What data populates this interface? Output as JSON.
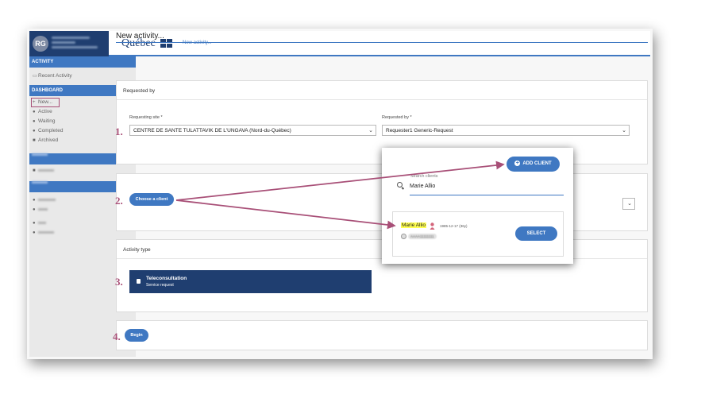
{
  "sidebar": {
    "avatar_initials": "RG",
    "sections": {
      "activity": "ACTIVITY",
      "dashboard": "DASHBOARD"
    },
    "activity_items": [
      {
        "label": "Recent Activity",
        "icon": "clock-icon"
      }
    ],
    "dashboard_items": [
      {
        "label": "New...",
        "icon": "plus-icon"
      },
      {
        "label": "Active",
        "icon": "info-icon"
      },
      {
        "label": "Waiting",
        "icon": "clock-icon"
      },
      {
        "label": "Completed",
        "icon": "check-icon"
      },
      {
        "label": "Archived",
        "icon": "folder-icon"
      }
    ]
  },
  "header": {
    "logo": "Québec",
    "breadcrumb": "New activity..."
  },
  "main": {
    "title": "New activity...",
    "requested_by": {
      "heading": "Requested by",
      "site_label": "Requesting site *",
      "site_value": "CENTRE DE SANTE TULATTAVIK DE L'UNGAVA (Nord-du-Québec)",
      "requester_label": "Requested by *",
      "requester_value": "Requester1 Generic-Request"
    },
    "client": {
      "choose_button": "Choose a client"
    },
    "activity_type": {
      "heading": "Activity type",
      "tile_title": "Teleconsultation",
      "tile_subtitle": "Service request"
    },
    "begin_button": "Begin"
  },
  "steps": [
    "1.",
    "2.",
    "3.",
    "4."
  ],
  "popup": {
    "add_client_button": "ADD CLIENT",
    "search_label": "Search clients",
    "search_value": "Marie Allio",
    "result": {
      "name": "Marie Allio",
      "dob": "1985-12-17 (36y)",
      "id": "AAAA11111111",
      "select_button": "SELECT"
    }
  },
  "colors": {
    "primary": "#3f78c2",
    "navy": "#1f3e70",
    "annotation": "#a84f77",
    "highlight": "#ffff52"
  }
}
